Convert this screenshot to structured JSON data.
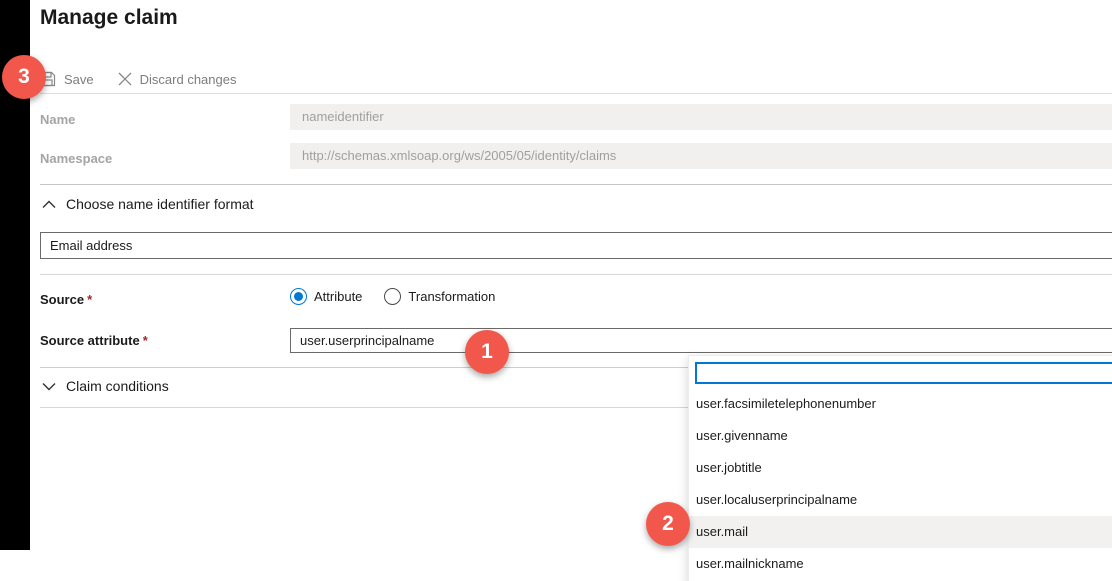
{
  "page": {
    "title": "Manage claim"
  },
  "toolbar": {
    "save_label": "Save",
    "discard_label": "Discard changes"
  },
  "form": {
    "name": {
      "label": "Name",
      "value": "nameidentifier"
    },
    "namespace": {
      "label": "Namespace",
      "value": "http://schemas.xmlsoap.org/ws/2005/05/identity/claims"
    },
    "name_identifier_section": {
      "label": "Choose name identifier format",
      "selected_format": "Email address"
    },
    "source": {
      "label": "Source",
      "required_marker": "*",
      "options": [
        {
          "label": "Attribute",
          "selected": true
        },
        {
          "label": "Transformation",
          "selected": false
        }
      ]
    },
    "source_attribute": {
      "label": "Source attribute",
      "required_marker": "*",
      "value": "user.userprincipalname"
    },
    "claim_conditions_section": {
      "label": "Claim conditions"
    }
  },
  "dropdown": {
    "search_value": "",
    "items": [
      {
        "label": "user.facsimiletelephonenumber",
        "highlighted": false
      },
      {
        "label": "user.givenname",
        "highlighted": false
      },
      {
        "label": "user.jobtitle",
        "highlighted": false
      },
      {
        "label": "user.localuserprincipalname",
        "highlighted": false
      },
      {
        "label": "user.mail",
        "highlighted": true
      },
      {
        "label": "user.mailnickname",
        "highlighted": false
      }
    ]
  },
  "annotations": {
    "badge_1": "1",
    "badge_2": "2",
    "badge_3": "3",
    "badge_color": "#f2574b"
  },
  "colors": {
    "accent_blue": "#0078d4",
    "required_red": "#a4262c",
    "disabled_field_bg": "#f1f0ee",
    "disabled_text": "#a19f9d",
    "sidebar_black": "#000000"
  }
}
